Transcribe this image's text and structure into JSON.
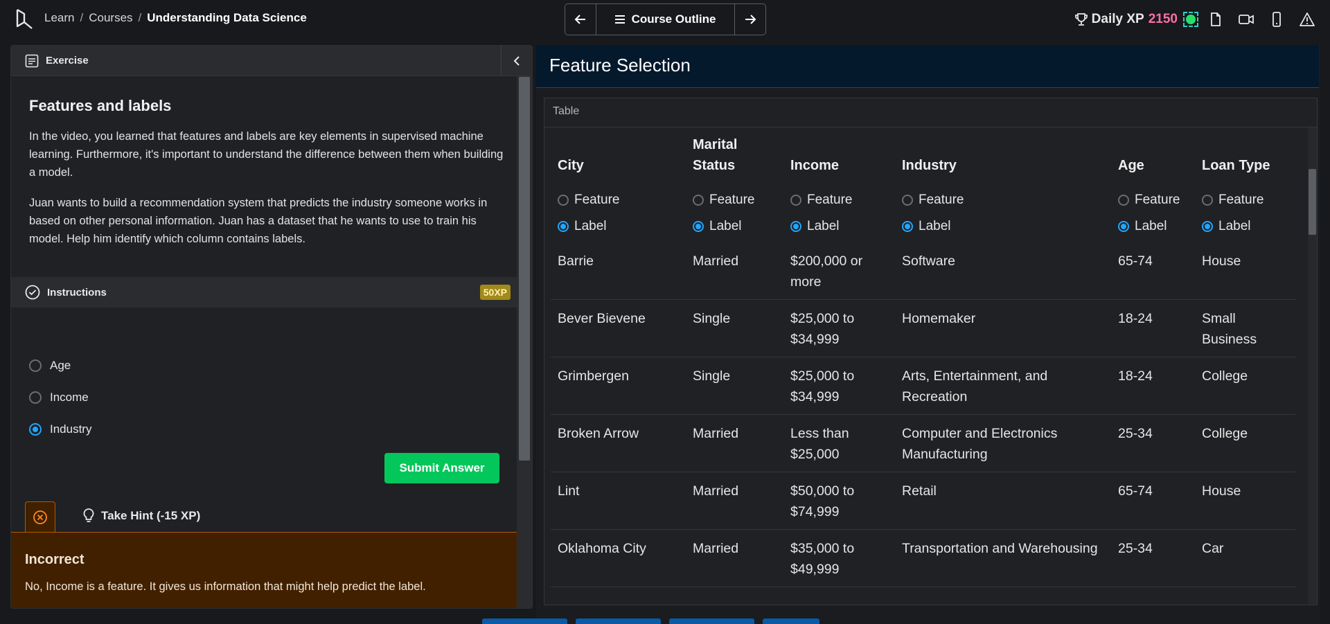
{
  "breadcrumb": {
    "items": [
      "Learn",
      "Courses",
      "Understanding Data Science"
    ],
    "separator": "/"
  },
  "nav": {
    "outline_label": "Course Outline"
  },
  "header": {
    "xp_label": "Daily XP",
    "xp_value": "2150"
  },
  "exercise": {
    "section_label": "Exercise",
    "title": "Features and labels",
    "paragraph1": "In the video, you learned that features and labels are key elements in supervised machine learning. Furthermore, it's important to understand the difference between them when building a model.",
    "paragraph2": "Juan wants to build a recommendation system that predicts the industry someone works in based on other personal information. Juan has a dataset that he wants to use to train his model. Help him identify which column contains labels.",
    "instructions_label": "Instructions",
    "xp_badge": "50XP",
    "options": [
      {
        "label": "Age",
        "selected": false
      },
      {
        "label": "Income",
        "selected": false
      },
      {
        "label": "Industry",
        "selected": true
      }
    ],
    "submit_label": "Submit Answer",
    "hint_label": "Take Hint (-15 XP)",
    "feedback_title": "Incorrect",
    "feedback_message": "No, Income is a feature. It gives us information that might help predict the label."
  },
  "panel": {
    "title": "Feature Selection",
    "table_caption": "Table"
  },
  "table": {
    "columns": [
      "City",
      "Marital Status",
      "Income",
      "Industry",
      "Age",
      "Loan Type"
    ],
    "feature_label": "Feature",
    "label_label": "Label",
    "selections": [
      "Label",
      "Label",
      "Label",
      "Label",
      "Label",
      "Label"
    ],
    "rows": [
      [
        "Barrie",
        "Married",
        "$200,000 or more",
        "Software",
        "65-74",
        "House"
      ],
      [
        "Bever Bievene",
        "Single",
        "$25,000 to $34,999",
        "Homemaker",
        "18-24",
        "Small Business"
      ],
      [
        "Grimbergen",
        "Single",
        "$25,000 to $34,999",
        "Arts, Entertainment, and Recreation",
        "18-24",
        "College"
      ],
      [
        "Broken Arrow",
        "Married",
        "Less than $25,000",
        "Computer and Electronics Manufacturing",
        "25-34",
        "College"
      ],
      [
        "Lint",
        "Married",
        "$50,000 to $74,999",
        "Retail",
        "65-74",
        "House"
      ],
      [
        "Oklahoma City",
        "Married",
        "$35,000 to $49,999",
        "Transportation and Warehousing",
        "25-34",
        "Car"
      ]
    ]
  },
  "colors": {
    "accent_green": "#03c75a",
    "xp_pink": "#ff6ea9",
    "radio_blue": "#22a5ff",
    "error_bg": "#412000",
    "header_navy": "#05192d"
  }
}
